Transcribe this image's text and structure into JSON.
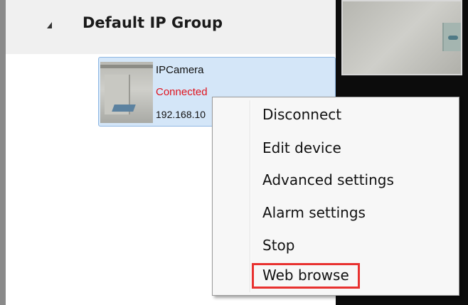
{
  "device_tree": {
    "group_title": "Default IP Group",
    "device": {
      "name": "IPCamera",
      "status": "Connected",
      "ip": "192.168.10"
    }
  },
  "context_menu": {
    "items": [
      {
        "label": "Disconnect"
      },
      {
        "label": "Edit device"
      },
      {
        "label": "Advanced settings"
      },
      {
        "label": "Alarm settings"
      },
      {
        "label": "Stop"
      },
      {
        "label": "Web browse",
        "highlighted": true
      }
    ]
  },
  "colors": {
    "status_connected": "#e0141e",
    "selection_bg": "#d4e6f8",
    "highlight_box": "#e8312f"
  },
  "icons": {
    "group_expander": "expanded-triangle-icon"
  }
}
